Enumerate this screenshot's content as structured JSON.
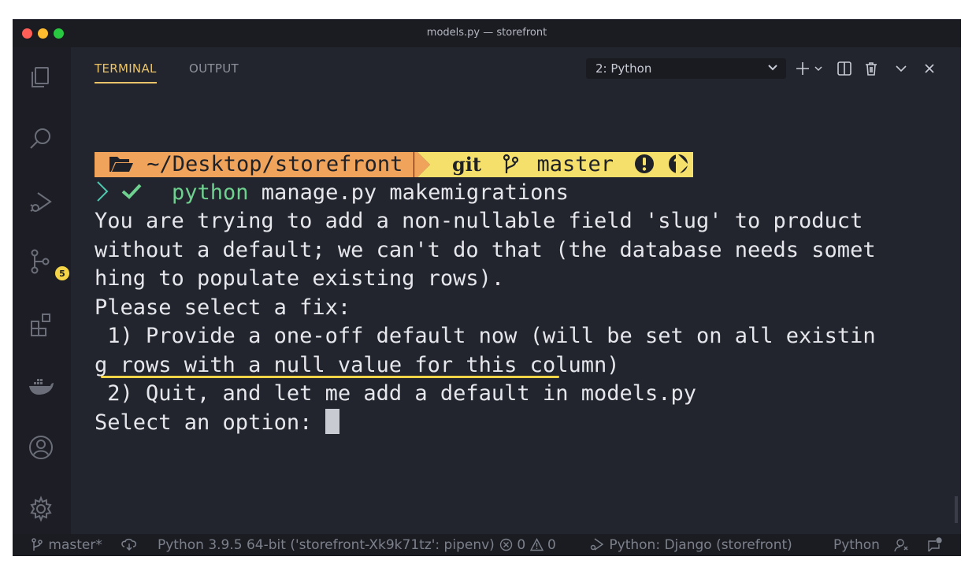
{
  "window": {
    "title": "models.py — storefront"
  },
  "panel": {
    "tabs": [
      {
        "label": "TERMINAL",
        "active": true
      },
      {
        "label": "OUTPUT",
        "active": false
      }
    ],
    "terminal_select": {
      "value": "2: Python"
    }
  },
  "activity_bar": {
    "source_control_badge": "5"
  },
  "terminal": {
    "prompt_path": "~/Desktop/storefront",
    "prompt_git_label": "git",
    "prompt_branch": "master",
    "command_program": "python",
    "command_args": " manage.py makemigrations",
    "output_lines": [
      "You are trying to add a non-nullable field 'slug' to product",
      "without a default; we can't do that (the database needs somet",
      "hing to populate existing rows).",
      "Please select a fix:"
    ],
    "option1_highlight": " 1) Provide a one-off default now",
    "option1_rest": " (will be set on all existin",
    "option1_cont": "g rows with a null value for this column)",
    "option2": " 2) Quit, and let me add a default in models.py",
    "select_prompt": "Select an option: "
  },
  "status_bar": {
    "branch": "master*",
    "interpreter": "Python 3.9.5 64-bit ('storefront-Xk9k71tz': pipenv)",
    "errors": "0",
    "warnings": "0",
    "debug_config": "Python: Django (storefront)",
    "language": "Python"
  },
  "colors": {
    "background": "#23252e",
    "accent_tab": "#e9c46a",
    "prompt_path_bg": "#f0a35b",
    "prompt_git_bg": "#f4e06b",
    "python_green": "#6fd18f",
    "underline_yellow": "#f5d547"
  },
  "icons": {
    "activity": [
      "explorer-icon",
      "search-icon",
      "run-debug-icon",
      "source-control-icon",
      "extensions-icon",
      "docker-icon",
      "account-icon",
      "settings-gear-icon"
    ]
  }
}
